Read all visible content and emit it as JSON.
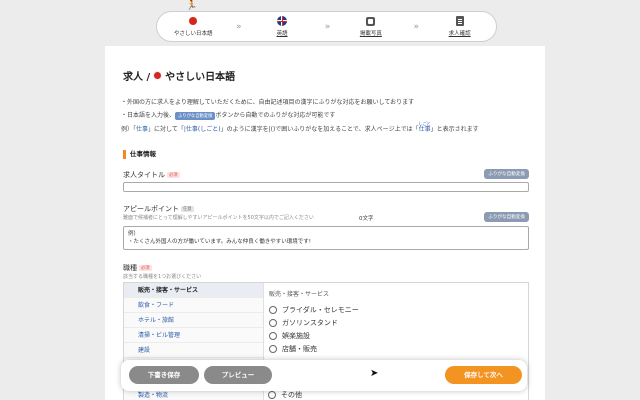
{
  "stepper": {
    "runner_icon": "running-person-icon",
    "steps": [
      {
        "label": "やさしい日本語",
        "icon": "japan-flag-icon"
      },
      {
        "label": "英語",
        "icon": "uk-flag-icon"
      },
      {
        "label": "掲載写真",
        "icon": "photo-icon"
      },
      {
        "label": "求人確認",
        "icon": "document-icon"
      }
    ],
    "separator": "»"
  },
  "page": {
    "title_prefix": "求人 /",
    "title": "やさしい日本語",
    "notes": {
      "line1": "・外国の方に求人をより理解していただくために、自由記述項目の漢字にふりがな対応をお願いしております",
      "line2_a": "・日本語を入力後、",
      "line2_badge": "ふりがな自動変換",
      "line2_b": "ボタンから自動でのふりがな対応が可能です",
      "line3_a": "例）「",
      "line3_w1": "仕事",
      "line3_b": "」に対して「",
      "line3_w2": "|仕事(しごと)",
      "line3_c": "」のように漢字を|()で囲いふりがなを加えることで、求人ページ上では「",
      "line3_ruby": "しごと",
      "line3_w3": "仕事",
      "line3_d": "」と表示されます"
    }
  },
  "form": {
    "section_title": "仕事情報",
    "job_title": {
      "label": "求人タイトル",
      "badge": "必須",
      "furigana_button": "ふりがな自動変換",
      "value": ""
    },
    "appeal": {
      "label": "アピールポイント",
      "badge": "任意",
      "hint": "難面で候補者にとって理解しやすいアピールポイントを50文字以内でご記入ください",
      "count": "0文字",
      "furigana_button": "ふりがな自動変換",
      "placeholder_line1": "例）",
      "placeholder_line2": "・たくさん外国人の方が働いています。みんな仲良く働きやすい環境です!"
    },
    "category": {
      "label": "職種",
      "badge": "必須",
      "hint": "該当する職種を1つお選びください",
      "list": [
        "販売・接客・サービス",
        "飲食・フード",
        "ホテル・旅館",
        "清掃・ビル管理",
        "建設"
      ],
      "hidden_item": "製造・物流",
      "panel_title": "販売・接客・サービス",
      "options": [
        "ブライダル・セレモニー",
        "ガソリンスタンド",
        "娯楽施設",
        "店舗・販売"
      ],
      "option_other": "その他"
    }
  },
  "actions": {
    "draft": "下書き保存",
    "preview": "プレビュー",
    "next": "保存して次へ"
  },
  "colors": {
    "accent": "#f39422",
    "link": "#2958a8",
    "required": "#e2514c",
    "furigana_btn": "#8b9bb3"
  }
}
